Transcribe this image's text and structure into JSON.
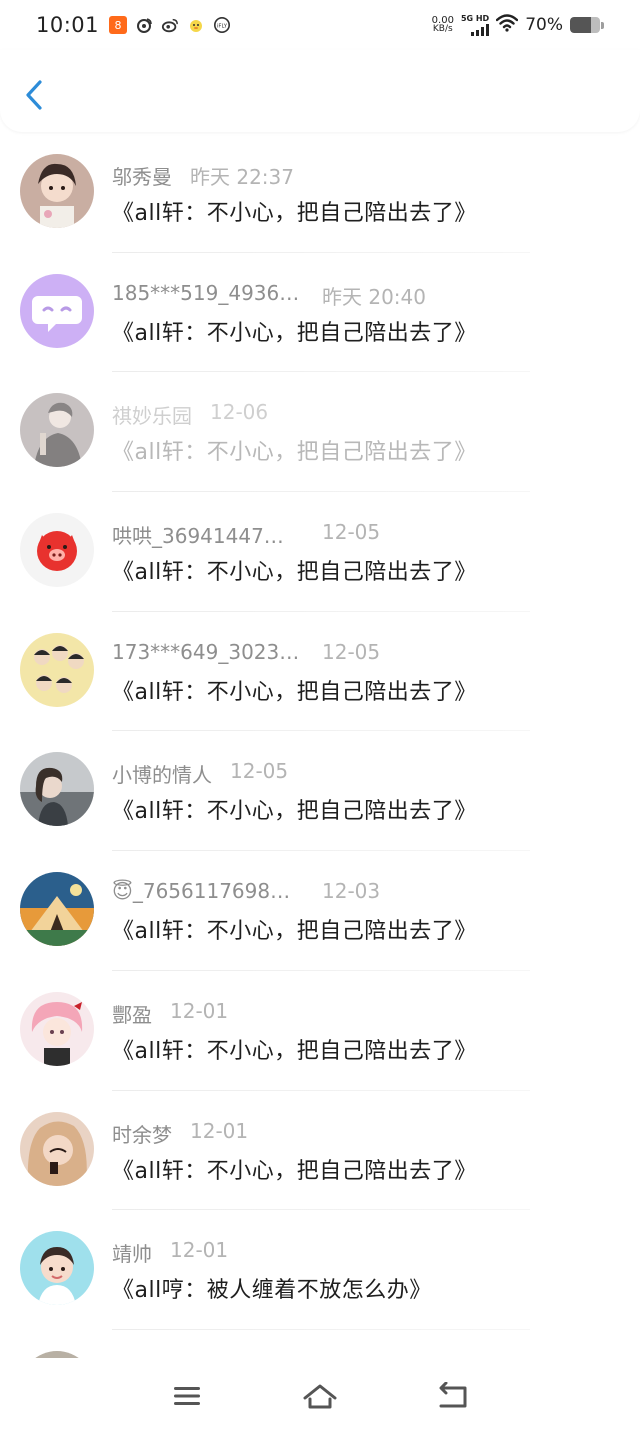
{
  "status": {
    "time": "10:01",
    "net_speed_value": "0.00",
    "net_speed_unit": "KB/s",
    "signal_label": "5G HD",
    "battery_pct": "70%",
    "battery_level": 0.7,
    "left_icons": [
      "app-notification-icon",
      "weibo-icon",
      "weibo-icon",
      "duck-icon",
      "ifly-icon"
    ]
  },
  "header": {
    "back_icon": "chevron-left-icon",
    "accent": "#2d8cd8"
  },
  "items": [
    {
      "name": "邬秀曼",
      "time": "昨天 22:37",
      "title": "《all轩：不小心，把自己陪出去了》",
      "avatar_color": "#a9837a"
    },
    {
      "name": "185***519_4936…",
      "time": "昨天 20:40",
      "title": "《all轩：不小心，把自己陪出去了》",
      "avatar_color": "#c9a7f2"
    },
    {
      "name": "祺妙乐园",
      "time": "12-06",
      "title": "《all轩：不小心，把自己陪出去了》",
      "avatar_color": "#6f6b6b"
    },
    {
      "name": "哄哄_36941447…",
      "time": "12-05",
      "title": "《all轩：不小心，把自己陪出去了》",
      "avatar_color": "#f3f3f3"
    },
    {
      "name": "173***649_3023…",
      "time": "12-05",
      "title": "《all轩：不小心，把自己陪出去了》",
      "avatar_color": "#f0e2a0"
    },
    {
      "name": "小博的情人",
      "time": "12-05",
      "title": "《all轩：不小心，把自己陪出去了》",
      "avatar_color": "#8a8e92"
    },
    {
      "name": "😇_7656117698…",
      "time": "12-03",
      "title": "《all轩：不小心，把自己陪出去了》",
      "avatar_color": "#2a6a9a"
    },
    {
      "name": "酆盈",
      "time": "12-01",
      "title": "《all轩：不小心，把自己陪出去了》",
      "avatar_color": "#f2c6cf"
    },
    {
      "name": "时余梦",
      "time": "12-01",
      "title": "《all轩：不小心，把自己陪出去了》",
      "avatar_color": "#b88a6a"
    },
    {
      "name": "靖帅",
      "time": "12-01",
      "title": "《all哼：被人缠着不放怎么办》",
      "avatar_color": "#8fd6e6"
    }
  ],
  "nav": {
    "menu_icon": "menu-icon",
    "home_icon": "home-icon",
    "back_icon": "back-icon"
  }
}
